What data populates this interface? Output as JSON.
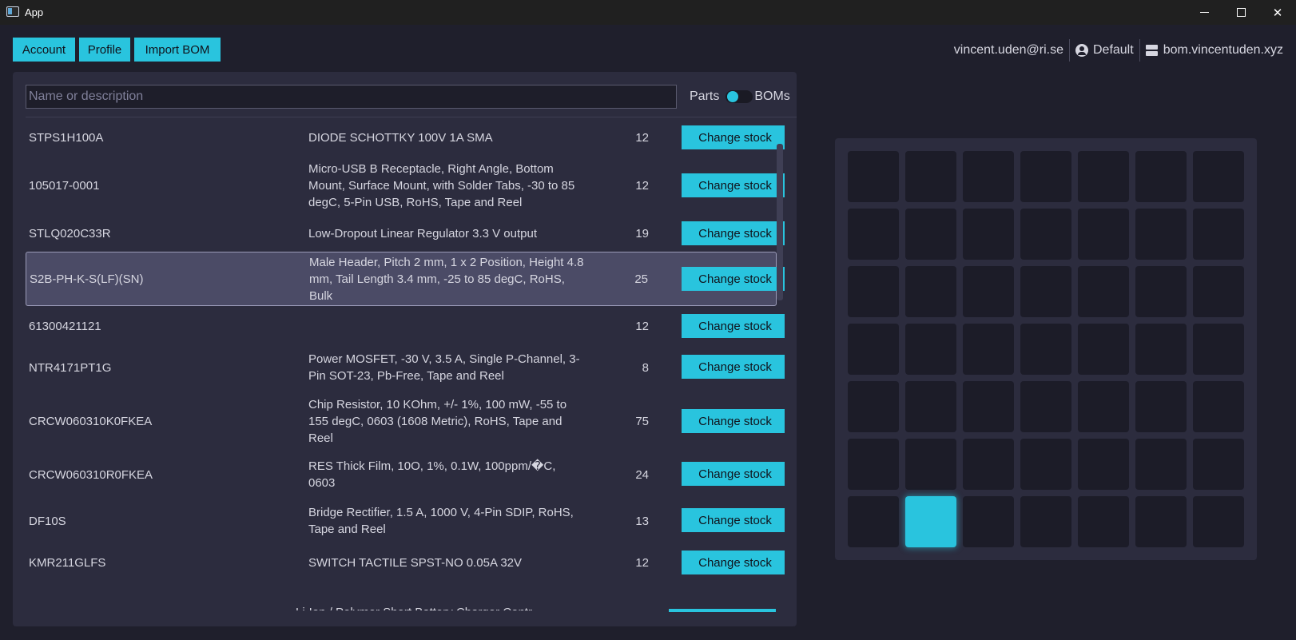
{
  "window": {
    "title": "App"
  },
  "toolbar": {
    "account_label": "Account",
    "profile_label": "Profile",
    "import_label": "Import BOM"
  },
  "header": {
    "email": "vincent.uden@ri.se",
    "profile_name": "Default",
    "server": "bom.vincentuden.xyz"
  },
  "search": {
    "placeholder": "Name or description",
    "value": ""
  },
  "toggle": {
    "left_label": "Parts",
    "right_label": "BOMs",
    "state": "Parts"
  },
  "parts": [
    {
      "part": "STPS1H100A",
      "description": "DIODE SCHOTTKY 100V 1A SMA",
      "qty": "12",
      "action": "Change stock"
    },
    {
      "part": "105017-0001",
      "description": "Micro-USB B Receptacle, Right Angle, Bottom Mount, Surface Mount, with Solder Tabs, -30 to 85 degC, 5-Pin USB, RoHS, Tape and Reel",
      "qty": "12",
      "action": "Change stock"
    },
    {
      "part": "STLQ020C33R",
      "description": "Low-Dropout Linear Regulator 3.3 V output",
      "qty": "19",
      "action": "Change stock"
    },
    {
      "part": "S2B-PH-K-S(LF)(SN)",
      "description": "Male Header, Pitch 2 mm, 1 x 2 Position, Height 4.8 mm, Tail Length 3.4 mm, -25 to 85 degC, RoHS, Bulk",
      "qty": "25",
      "action": "Change stock"
    },
    {
      "part": "61300421121",
      "description": "",
      "qty": "12",
      "action": "Change stock"
    },
    {
      "part": "NTR4171PT1G",
      "description": "Power MOSFET, -30 V, 3.5 A, Single P-Channel, 3-Pin SOT-23, Pb-Free, Tape and Reel",
      "qty": "8",
      "action": "Change stock"
    },
    {
      "part": "CRCW060310K0FKEA",
      "description": "Chip Resistor, 10 KOhm, +/- 1%, 100 mW, -55 to 155 degC, 0603 (1608 Metric), RoHS, Tape and Reel",
      "qty": "75",
      "action": "Change stock"
    },
    {
      "part": "CRCW060310R0FKEA",
      "description": "RES Thick Film, 10O, 1%, 0.1W, 100ppm/�C, 0603",
      "qty": "24",
      "action": "Change stock"
    },
    {
      "part": "DF10S",
      "description": "Bridge Rectifier, 1.5 A, 1000 V, 4-Pin SDIP, RoHS, Tape and Reel",
      "qty": "13",
      "action": "Change stock"
    },
    {
      "part": "KMR211GLFS",
      "description": "SWITCH TACTILE SPST-NO 0.05A 32V",
      "qty": "12",
      "action": "Change stock"
    }
  ],
  "partial_row": {
    "description": "Li-Ion / Polymer Short Battery Charger Contr"
  },
  "grid": {
    "rows": 7,
    "cols": 7,
    "active_row": 6,
    "active_col": 1,
    "accent": "#29c4de"
  },
  "colors": {
    "accent": "#29c4de",
    "background": "#1f1f2c",
    "panel": "#2c2c3e"
  }
}
